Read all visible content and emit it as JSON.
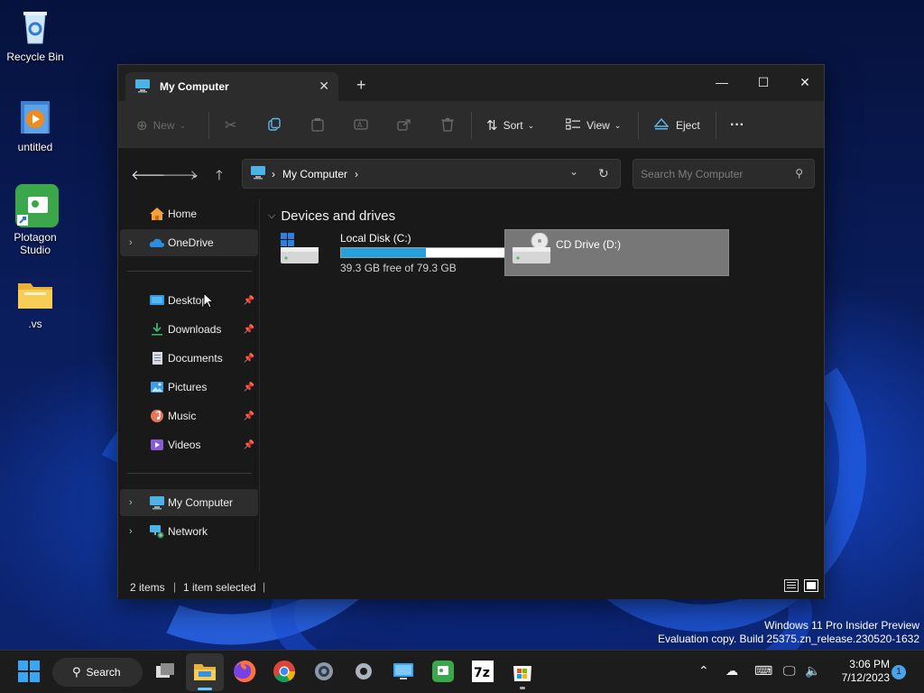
{
  "desktop": {
    "icons": [
      {
        "label": "Recycle Bin"
      },
      {
        "label": "untitled"
      },
      {
        "label": "Plotagon Studio"
      },
      {
        "label": ".vs"
      }
    ]
  },
  "window": {
    "tab_title": "My Computer",
    "toolbar": {
      "new_label": "New",
      "sort_label": "Sort",
      "view_label": "View",
      "eject_label": "Eject",
      "more_label": "···"
    },
    "address": {
      "location": "My Computer",
      "search_placeholder": "Search My Computer"
    },
    "nav": {
      "home": "Home",
      "onedrive": "OneDrive",
      "quick_access": [
        {
          "label": "Desktop"
        },
        {
          "label": "Downloads"
        },
        {
          "label": "Documents"
        },
        {
          "label": "Pictures"
        },
        {
          "label": "Music"
        },
        {
          "label": "Videos"
        }
      ],
      "my_computer": "My Computer",
      "network": "Network"
    },
    "content": {
      "group_title": "Devices and drives",
      "drives": [
        {
          "name": "Local Disk (C:)",
          "detail": "39.3 GB free of 79.3 GB",
          "used_fraction": 0.504
        },
        {
          "name": "CD Drive (D:)"
        }
      ]
    },
    "status": {
      "items": "2 items",
      "selected": "1 item selected"
    }
  },
  "watermark": {
    "line1": "Windows 11 Pro Insider Preview",
    "line2": "Evaluation copy. Build 25375.zn_release.230520-1632"
  },
  "taskbar": {
    "search_label": "Search",
    "time": "3:06 PM",
    "date": "7/12/2023",
    "notification_count": "1"
  },
  "colors": {
    "accent": "#26a0da",
    "window_bg": "#191919",
    "toolbar_bg": "#2c2c2c",
    "selection": "#777777"
  }
}
